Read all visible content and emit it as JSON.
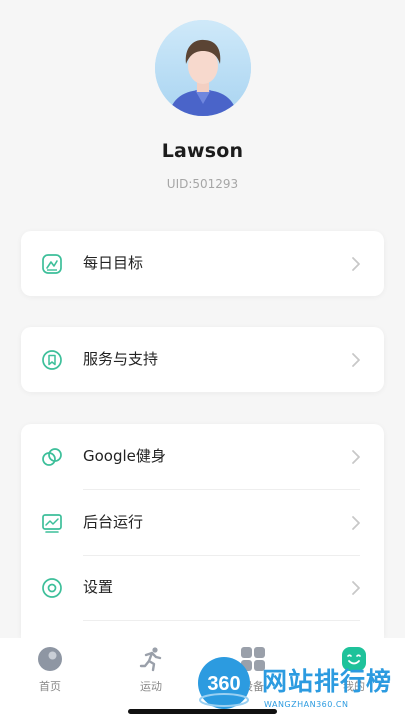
{
  "profile": {
    "username": "Lawson",
    "uid": "UID:501293"
  },
  "menu": {
    "daily_goal": "每日目标",
    "service_support": "服务与支持",
    "google_fit": "Google健身",
    "background_run": "后台运行",
    "settings": "设置"
  },
  "tabs": [
    {
      "label": "首页",
      "icon": "home-icon"
    },
    {
      "label": "运动",
      "icon": "running-icon"
    },
    {
      "label": "设备",
      "icon": "device-grid-icon"
    },
    {
      "label": "我的",
      "icon": "smile-icon"
    }
  ],
  "watermark": {
    "logo": "360",
    "text": "网站排行榜",
    "sub": "WANGZHAN360.CN"
  },
  "colors": {
    "accent": "#3dbf9a",
    "active_tab": "#1ec29a",
    "watermark": "#2c9be0"
  }
}
